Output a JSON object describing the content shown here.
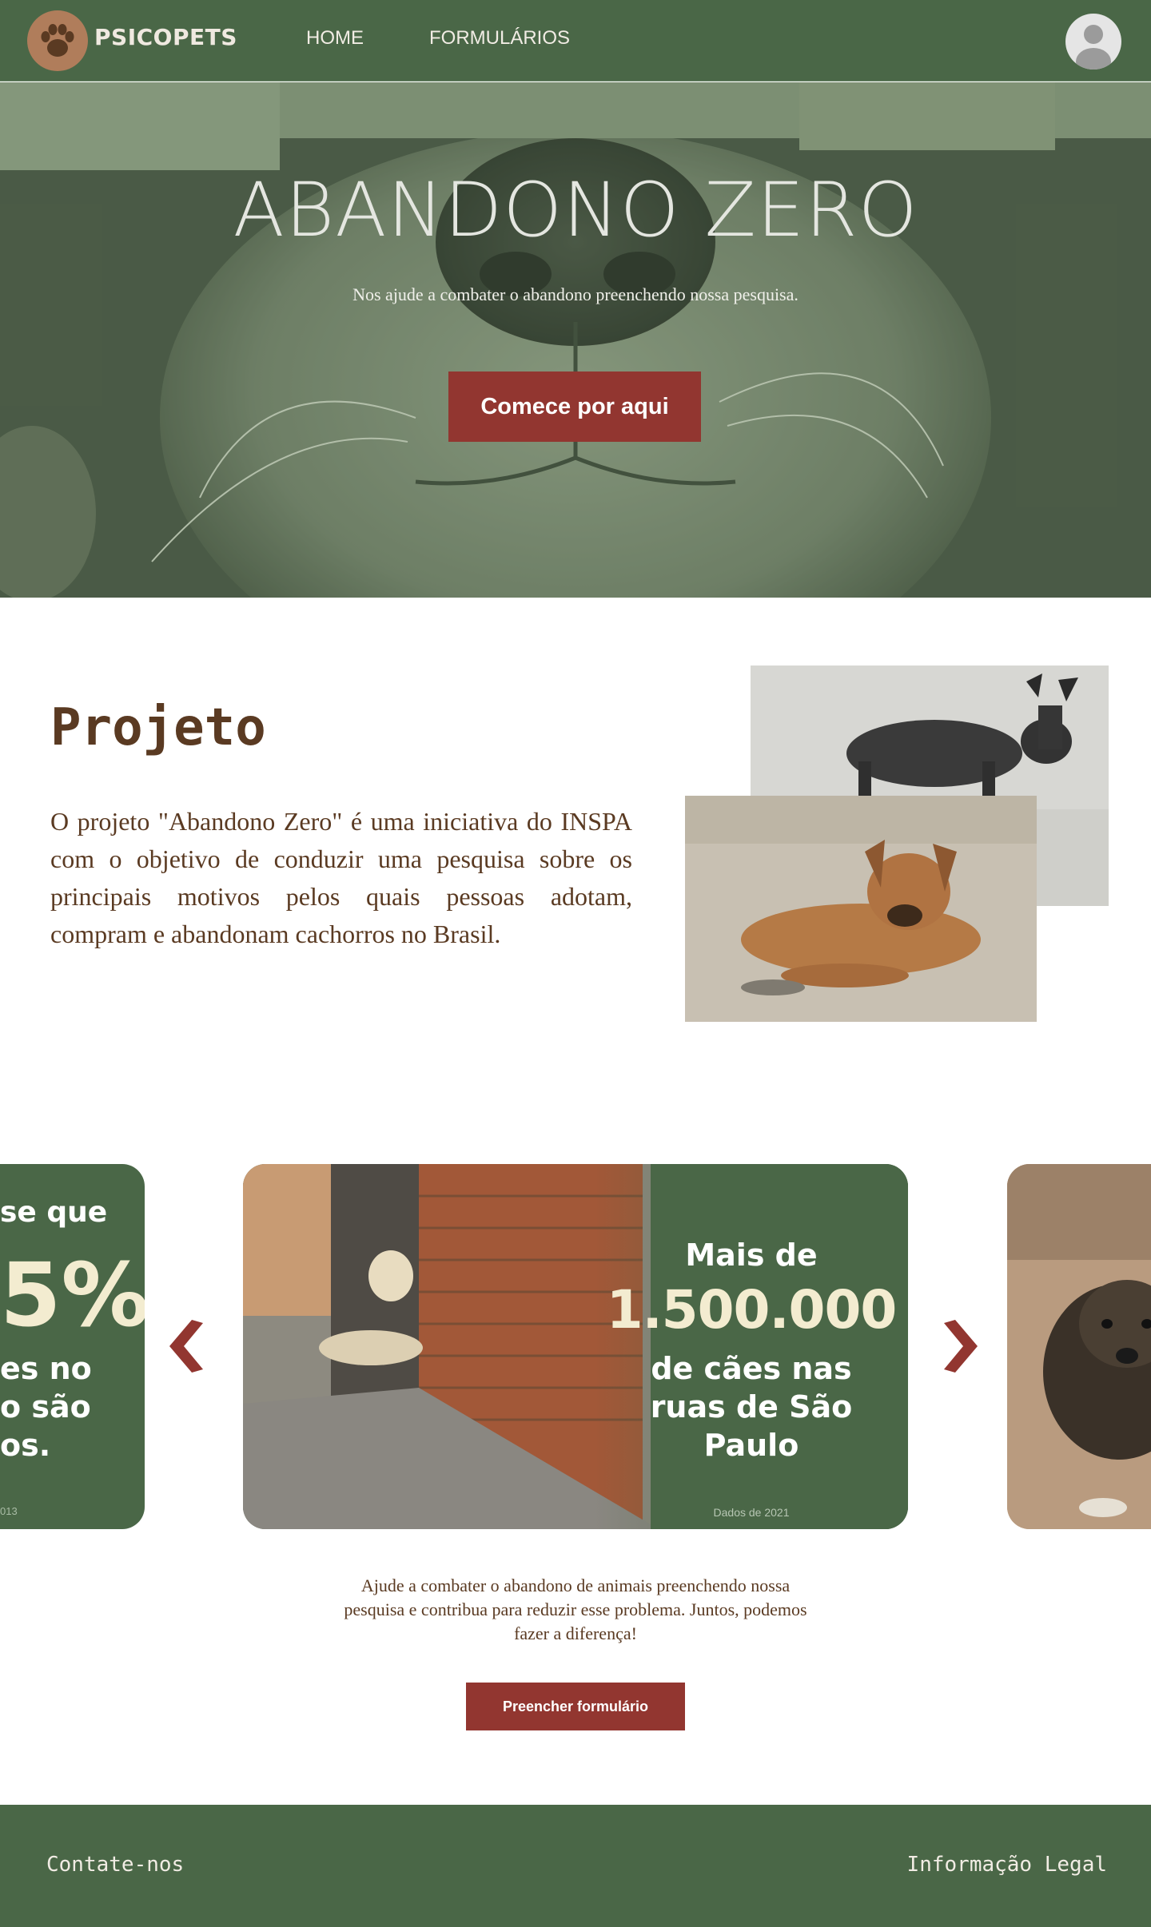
{
  "navbar": {
    "brand": "PSICOPETS",
    "links": [
      {
        "label": "HOME"
      },
      {
        "label": "FORMULÁRIOS"
      }
    ]
  },
  "hero": {
    "title": "ABANDONO ZERO",
    "subtitle": "Nos ajude a combater o abandono preenchendo nossa pesquisa.",
    "button_label": "Comece por aqui"
  },
  "projeto": {
    "title": "Projeto",
    "text": "O projeto \"Abandono Zero\" é uma iniciativa do INSPA com o objetivo de conduzir uma pesquisa sobre os principais motivos pelos quais pessoas adotam, compram e abandonam cachorros no Brasil."
  },
  "carousel": {
    "left_card": {
      "line1": "se que",
      "big": "5%",
      "line2": "es no",
      "line3": "o são",
      "line4": "os.",
      "footnote": "013"
    },
    "main_card": {
      "line1": "Mais de",
      "big": "1.500.000",
      "line2": "de cães nas ruas de São Paulo",
      "footnote": "Dados de 2021"
    },
    "cta_text": "Ajude a combater o abandono de animais preenchendo nossa pesquisa e contribua para reduzir esse problema. Juntos, podemos fazer a diferença!",
    "cta_button": "Preencher formulário"
  },
  "footer": {
    "contact": "Contate-nos",
    "legal": "Informação Legal"
  },
  "colors": {
    "primary_green": "#4a6747",
    "accent_red": "#923630",
    "text_brown": "#5a3a22",
    "cream": "#f3ecd0"
  },
  "icons": [
    "paw-icon",
    "user-avatar-icon",
    "chevron-left-icon",
    "chevron-right-icon"
  ]
}
